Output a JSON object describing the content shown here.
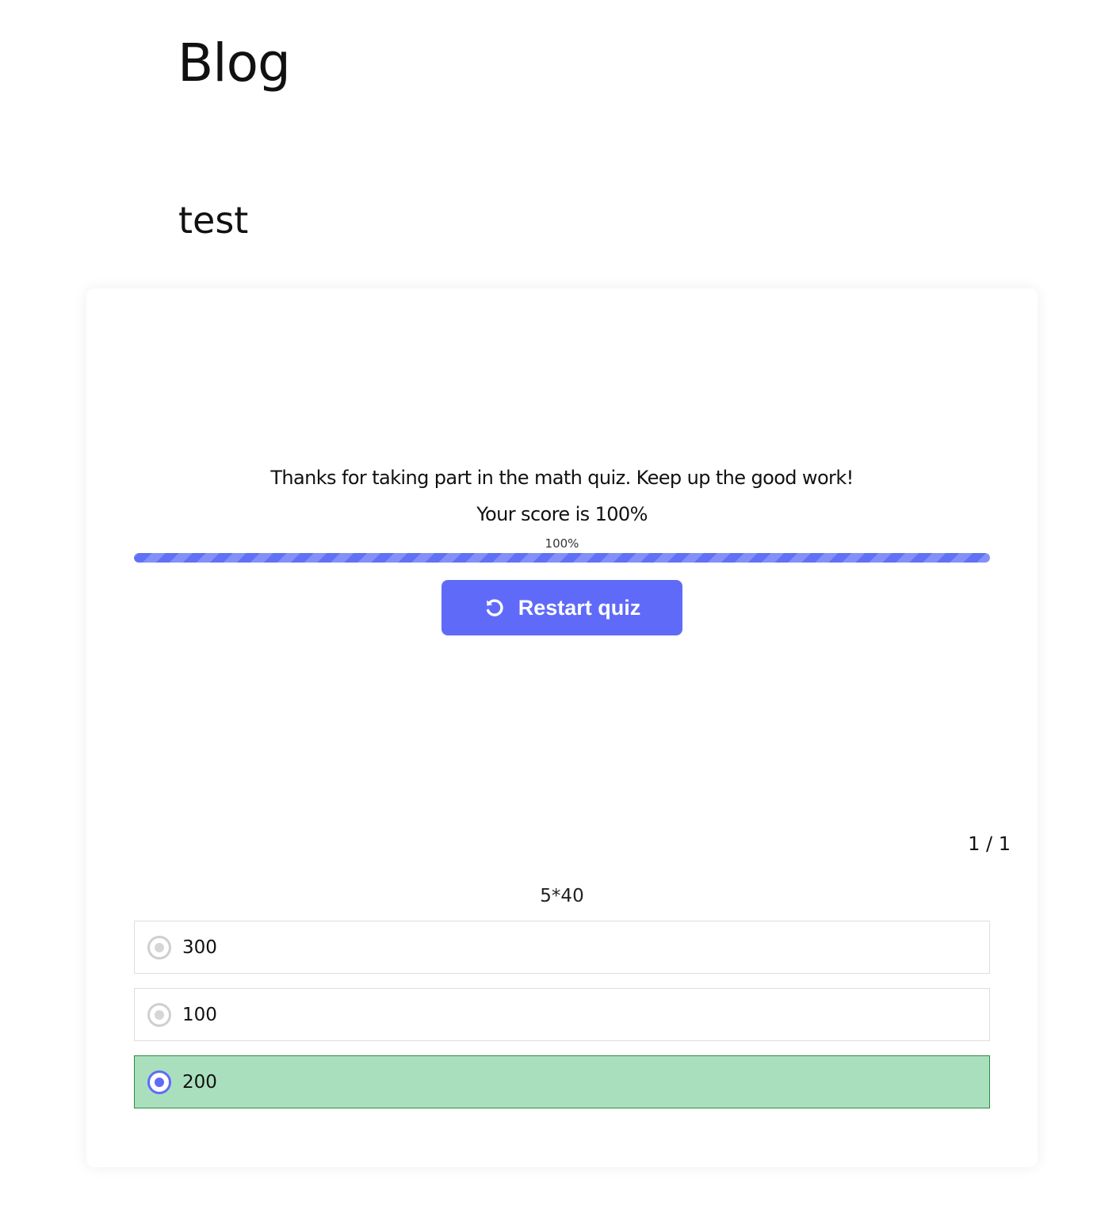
{
  "page": {
    "blog_title": "Blog",
    "post_title": "test"
  },
  "quiz": {
    "result_message": "Thanks for taking part in the math quiz. Keep up the good work!",
    "score_text": "Your score is 100%",
    "progress": {
      "percent": 100,
      "label": "100%"
    },
    "restart_label": "Restart quiz",
    "counter": "1 / 1",
    "question": "5*40",
    "answers": [
      {
        "label": "300",
        "state": "unselected"
      },
      {
        "label": "100",
        "state": "unselected"
      },
      {
        "label": "200",
        "state": "correct-selected"
      }
    ]
  },
  "colors": {
    "accent": "#5f6bf8",
    "progress_fill": "#6171f5",
    "correct_background": "#aadfbe",
    "correct_border": "#2e8b3c",
    "option_border": "#dddddd"
  },
  "icons": {
    "restart": "restart-icon",
    "radio_unselected": "radio-unselected-icon",
    "radio_selected": "radio-selected-icon"
  }
}
